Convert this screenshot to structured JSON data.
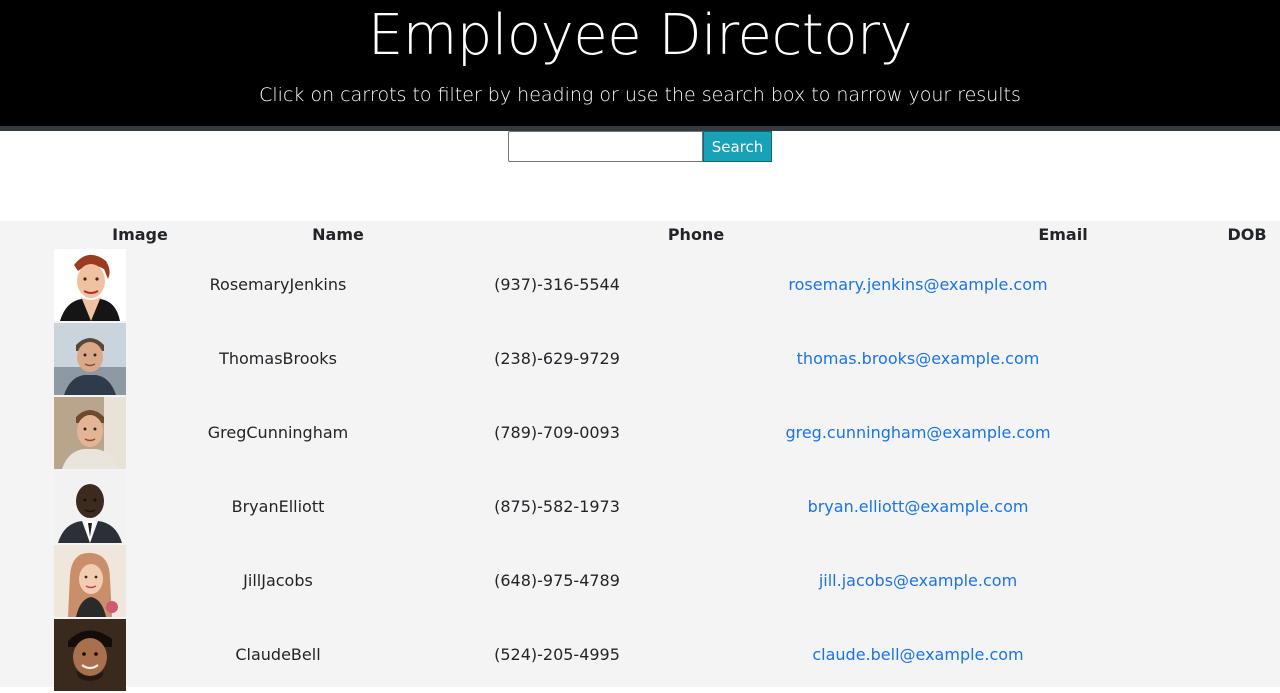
{
  "header": {
    "title": "Employee Directory",
    "subtitle": "Click on carrots to filter by heading or use the search box to narrow your results"
  },
  "search": {
    "value": "",
    "placeholder": "",
    "button_label": "Search"
  },
  "table": {
    "columns": [
      "Image",
      "Name",
      "Phone",
      "Email",
      "DOB"
    ],
    "rows": [
      {
        "name": "RosemaryJenkins",
        "phone": "(937)-316-5544",
        "email": "rosemary.jenkins@example.com",
        "dob": ""
      },
      {
        "name": "ThomasBrooks",
        "phone": "(238)-629-9729",
        "email": "thomas.brooks@example.com",
        "dob": ""
      },
      {
        "name": "GregCunningham",
        "phone": "(789)-709-0093",
        "email": "greg.cunningham@example.com",
        "dob": ""
      },
      {
        "name": "BryanElliott",
        "phone": "(875)-582-1973",
        "email": "bryan.elliott@example.com",
        "dob": ""
      },
      {
        "name": "JillJacobs",
        "phone": "(648)-975-4789",
        "email": "jill.jacobs@example.com",
        "dob": ""
      },
      {
        "name": "ClaudeBell",
        "phone": "(524)-205-4995",
        "email": "claude.bell@example.com",
        "dob": ""
      }
    ]
  },
  "colors": {
    "header_bg": "#000000",
    "header_bar": "#343a40",
    "search_button": "#17a2b8",
    "table_bg": "#f4f4f4",
    "link": "#1a73e8"
  }
}
